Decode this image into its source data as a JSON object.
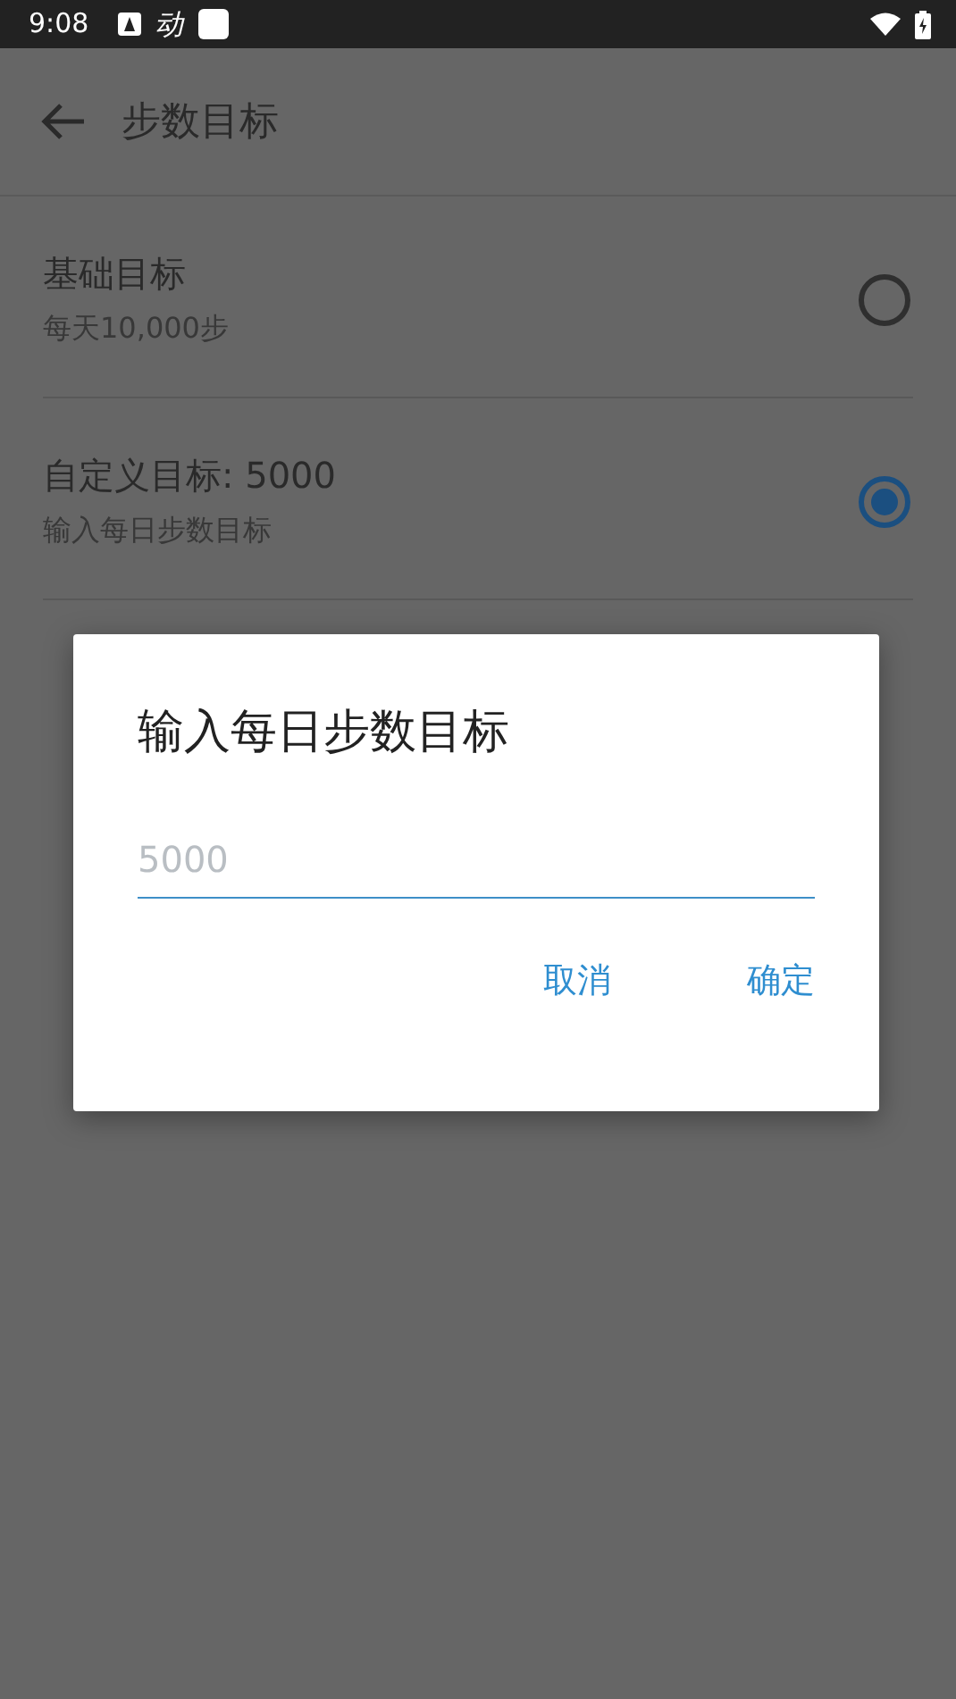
{
  "status_bar": {
    "time": "9:08",
    "notification_text": "动"
  },
  "app_bar": {
    "title": "步数目标"
  },
  "options": [
    {
      "title": "基础目标",
      "subtitle": "每天10,000步",
      "selected": false
    },
    {
      "title": "自定义目标: 5000",
      "subtitle": "输入每日步数目标",
      "selected": true
    }
  ],
  "dialog": {
    "title": "输入每日步数目标",
    "field": {
      "placeholder": "5000"
    },
    "buttons": [
      "取消",
      "确定"
    ]
  }
}
